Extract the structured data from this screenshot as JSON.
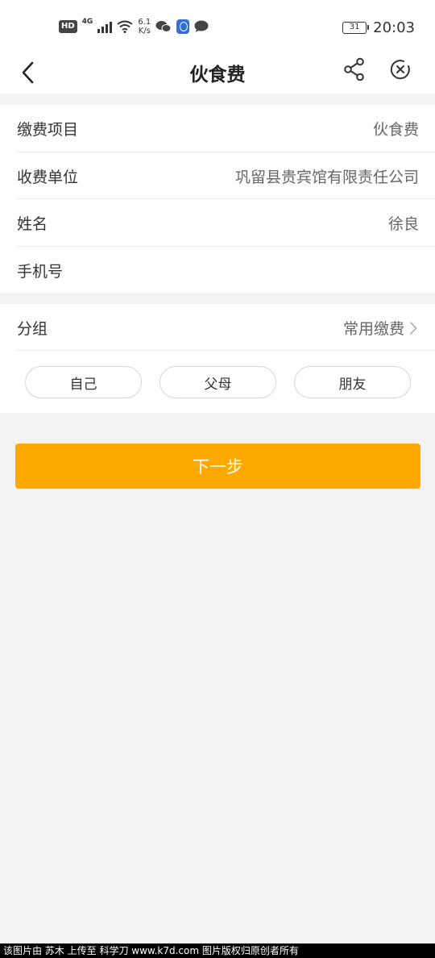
{
  "status_bar": {
    "hd": "HD",
    "network": "4G",
    "speed_value": "6.1",
    "speed_unit": "K/s",
    "battery": "31",
    "time": "20:03"
  },
  "header": {
    "title": "伙食费",
    "back_icon": "back-chevron-icon",
    "share_icon": "share-icon",
    "close_icon": "close-circle-icon"
  },
  "form": {
    "rows": [
      {
        "label": "缴费项目",
        "value": "伙食费"
      },
      {
        "label": "收费单位",
        "value": "巩留县贵宾馆有限责任公司"
      },
      {
        "label": "姓名",
        "value": "徐良"
      },
      {
        "label": "手机号",
        "value": ""
      }
    ]
  },
  "group": {
    "label": "分组",
    "value": "常用缴费",
    "chips": [
      "自己",
      "父母",
      "朋友"
    ]
  },
  "actions": {
    "next_label": "下一步"
  },
  "watermark": "该图片由 苏木 上传至 科学刀 www.k7d.com 图片版权归原创者所有",
  "colors": {
    "accent": "#ffa800",
    "background": "#f3f3f3"
  }
}
